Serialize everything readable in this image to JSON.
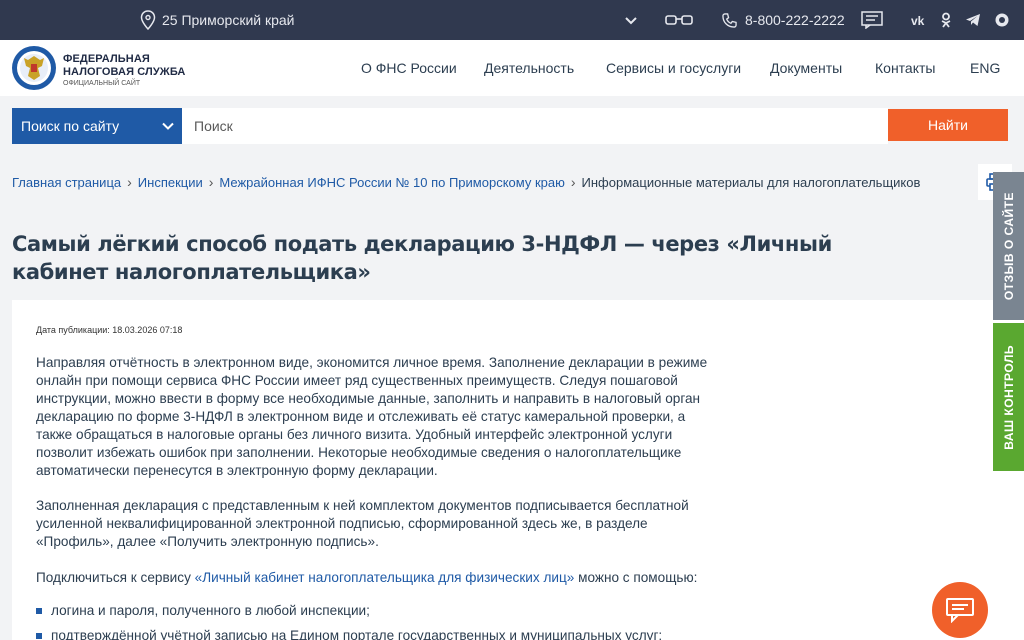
{
  "topbar": {
    "region": "25 Приморский край",
    "phone": "8-800-222-2222"
  },
  "header": {
    "logo_line1": "ФЕДЕРАЛЬНАЯ",
    "logo_line2": "НАЛОГОВАЯ СЛУЖБА",
    "logo_sub": "ОФИЦИАЛЬНЫЙ САЙТ",
    "nav": [
      "О ФНС России",
      "Деятельность",
      "Сервисы и госуслуги",
      "Документы",
      "Контакты",
      "ENG"
    ]
  },
  "search": {
    "category": "Поиск по сайту",
    "placeholder": "Поиск",
    "button": "Найти"
  },
  "breadcrumb": {
    "items": [
      "Главная страница",
      "Инспекции",
      "Межрайонная ИФНС России № 10 по Приморскому краю"
    ],
    "current": "Информационные материалы для налогоплательщиков"
  },
  "page": {
    "title": "Самый лёгкий способ подать декларацию 3-НДФЛ — через «Личный кабинет налогоплательщика»",
    "pubdate": "Дата публикации: 18.03.2026 07:18",
    "p1": "Направляя отчётность в электронном виде, экономится личное время. Заполнение декларации в режиме онлайн при помощи сервиса ФНС России имеет ряд существенных преимуществ. Следуя пошаговой инструкции, можно ввести в форму все необходимые данные, заполнить и направить в налоговый орган декларацию по форме 3-НДФЛ в электронном виде и отслеживать её статус камеральной проверки, а также обращаться в налоговые органы без личного визита. Удобный интерфейс электронной услуги позволит избежать ошибок при заполнении. Некоторые необходимые сведения о налогоплательщике автоматически перенесутся в электронную форму декларации.",
    "p2": "Заполненная декларация с представленным к ней комплектом документов подписывается бесплатной усиленной неквалифицированной электронной подписью, сформированной здесь же, в разделе «Профиль», далее «Получить электронную подпись».",
    "p3_before": "Подключиться к сервису ",
    "p3_link": "«Личный кабинет налогоплательщика для физических лиц»",
    "p3_after": " можно с помощью:",
    "list": [
      "логина и пароля, полученного в любой инспекции;",
      "подтверждённой учётной записью на Едином портале государственных и муниципальных услуг;"
    ]
  },
  "side": {
    "feedback": "ОТЗЫВ О САЙТЕ",
    "control": "ВАШ КОНТРОЛЬ"
  },
  "colors": {
    "topbar": "#30394f",
    "accent_blue": "#1f5aa6",
    "accent_orange": "#f0602a",
    "control_green": "#5aa830",
    "feedback_gray": "#7a8591"
  }
}
